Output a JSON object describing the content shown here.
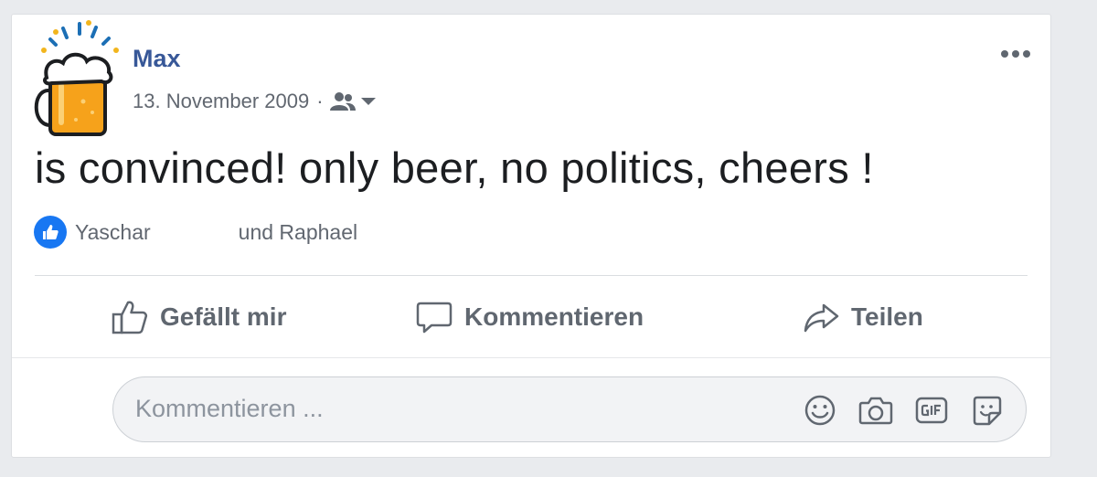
{
  "post": {
    "author": "Max",
    "date": "13. November 2009",
    "separator": "·",
    "audience_icon": "friends-icon",
    "text": "is convinced! only beer, no politics, cheers !"
  },
  "reactions": {
    "icon": "like-icon",
    "first_name": "Yaschar",
    "others": "und Raphael"
  },
  "actions": {
    "like_label": "Gefällt mir",
    "comment_label": "Kommentieren",
    "share_label": "Teilen"
  },
  "comment": {
    "placeholder": "Kommentieren ...",
    "icons": [
      "emoji-icon",
      "camera-icon",
      "gif-icon",
      "sticker-icon"
    ]
  },
  "colors": {
    "author": "#385898",
    "like_badge": "#1877f2",
    "background": "#e9ebee"
  }
}
